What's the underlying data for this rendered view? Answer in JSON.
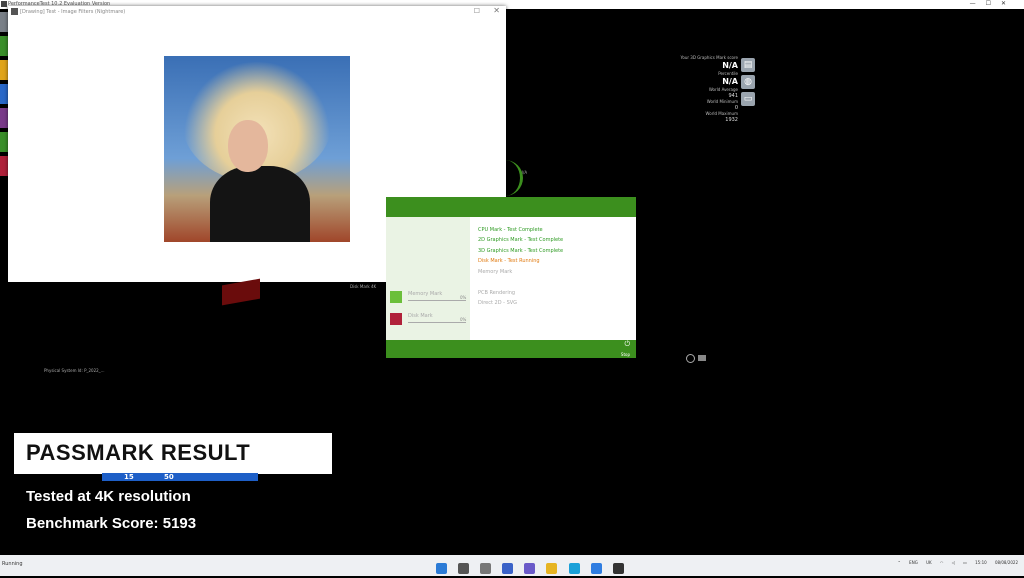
{
  "window": {
    "title": "PerformanceTest 10.2 Evaluation Version"
  },
  "viewer": {
    "title": "[Drawing] Test - Image Filters (Nightmare)"
  },
  "stats": {
    "graphics_label": "Your 3D Graphics Mark score",
    "graphics_value": "N/A",
    "percentile_label": "Percentile",
    "percentile_value": "N/A",
    "world_avg_label": "World Average",
    "world_avg_value": "941",
    "world_min_label": "World Minimum",
    "world_min_value": "0",
    "world_max_label": "World Maximum",
    "world_max_value": "1932"
  },
  "progress": {
    "tests": [
      {
        "text": "CPU Mark - Test Complete",
        "status": "ok"
      },
      {
        "text": "2D Graphics Mark - Test Complete",
        "status": "ok"
      },
      {
        "text": "3D Graphics Mark - Test Complete",
        "status": "ok"
      },
      {
        "text": "Disk Mark - Test Running",
        "status": "run"
      },
      {
        "text": "Memory Mark",
        "status": "gray"
      },
      {
        "text": "PCB Rendering",
        "status": "gray"
      },
      {
        "text": "Direct 2D - SVG",
        "status": "gray"
      }
    ],
    "items": [
      {
        "label": "Memory Mark",
        "pct": "0%"
      },
      {
        "label": "Disk Mark",
        "pct": "0%"
      }
    ],
    "stop_label": "Stop"
  },
  "tiny": {
    "ring_label": "N/A",
    "left_caption": "Physical System Id: P_2022_...",
    "small_caption": "Disk Mark 4K"
  },
  "overlay": {
    "title": "PASSMARK RESULT",
    "line1": "Tested at 4K resolution",
    "line2": "Benchmark Score: 5193",
    "strip_a": "15",
    "strip_b": "50"
  },
  "taskbar": {
    "left_text": "Running",
    "lang": "ENG",
    "region": "UK",
    "time": "15:10",
    "date": "08/08/2022"
  },
  "colors": {
    "accent_green": "#3c8f1e",
    "run_orange": "#e07a10",
    "ok_green": "#2e9a22"
  }
}
